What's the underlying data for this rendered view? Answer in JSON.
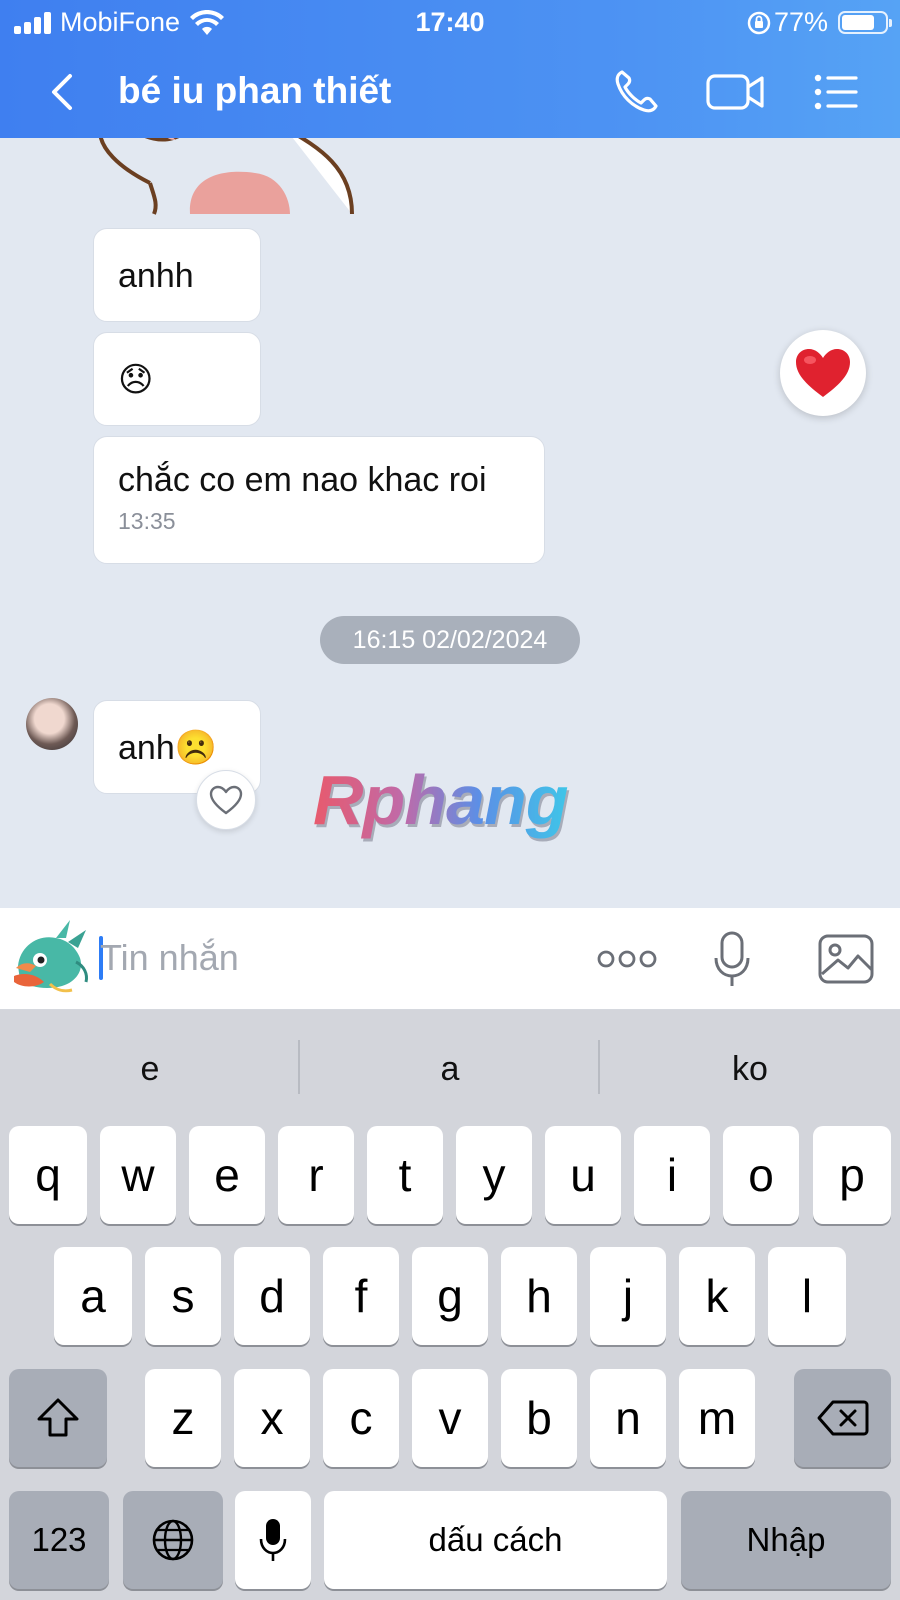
{
  "status_bar": {
    "carrier": "MobiFone",
    "time": "17:40",
    "battery": "77%",
    "battery_level": 0.77
  },
  "header": {
    "title": "bé iu phan thiết"
  },
  "messages": [
    {
      "text": "anhh"
    },
    {
      "text": "😞"
    },
    {
      "text": "chắc co em nao khac roi",
      "time": "13:35"
    }
  ],
  "date_divider": "16:15 02/02/2024",
  "last_message": {
    "text": "anh☹️"
  },
  "watermark": "Rphang",
  "composer": {
    "placeholder": "Tin nhắn"
  },
  "keyboard": {
    "suggestions": [
      "e",
      "a",
      "ko"
    ],
    "row1": [
      "q",
      "w",
      "e",
      "r",
      "t",
      "y",
      "u",
      "i",
      "o",
      "p"
    ],
    "row2": [
      "a",
      "s",
      "d",
      "f",
      "g",
      "h",
      "j",
      "k",
      "l"
    ],
    "row3": [
      "z",
      "x",
      "c",
      "v",
      "b",
      "n",
      "m"
    ],
    "numbers_key": "123",
    "space_key": "dấu cách",
    "return_key": "Nhập"
  },
  "colors": {
    "header": "#4a8cf2",
    "chat_bg": "#e2e8f1",
    "heart": "#e0222f",
    "keyboard_bg": "#d3d5db"
  }
}
